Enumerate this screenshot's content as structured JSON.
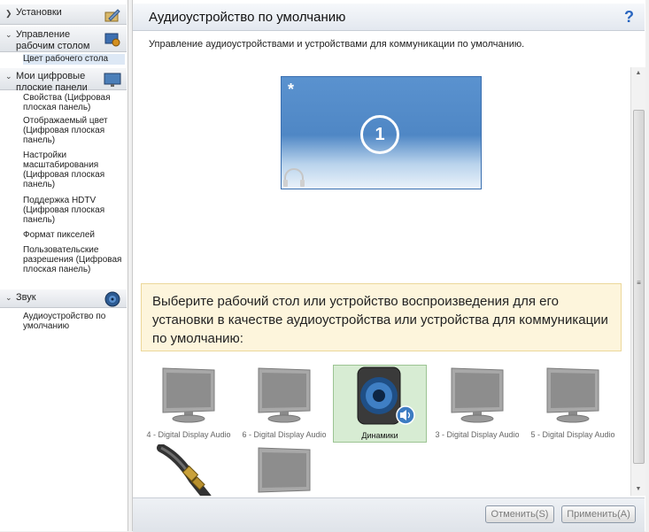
{
  "sidebar": {
    "sections": [
      {
        "label": "Установки"
      },
      {
        "label": "Управление рабочим столом"
      },
      {
        "label": "Мои цифровые плоские панели"
      },
      {
        "label": "Звук"
      }
    ],
    "items": [
      {
        "label": "Цвет рабочего стола"
      },
      {
        "label": "Свойства (Цифровая плоская панель)"
      },
      {
        "label": "Отображаемый цвет (Цифровая плоская панель)"
      },
      {
        "label": "Настройки масштабирования (Цифровая плоская панель)"
      },
      {
        "label": "Поддержка HDTV (Цифровая плоская панель)"
      },
      {
        "label": "Формат пикселей"
      },
      {
        "label": "Пользовательские разрешения (Цифровая плоская панель)"
      },
      {
        "label": "Аудиоустройство по умолчанию"
      }
    ]
  },
  "main": {
    "title": "Аудиоустройство по умолчанию",
    "help": "?",
    "description": "Управление аудиоустройствами и устройствами для коммуникации по умолчанию.",
    "desktop": {
      "star": "*",
      "number": "1"
    },
    "info": "Выберите рабочий стол или устройство воспроизведения для его установки в качестве аудиоустройства или устройства для коммуникации по умолчанию:",
    "devices": [
      {
        "label": "4 - Digital Display Audio",
        "icon": "monitor-icon"
      },
      {
        "label": "6 - Digital Display Audio",
        "icon": "monitor-icon"
      },
      {
        "label": "Динамики",
        "icon": "speaker-icon",
        "selected": true
      },
      {
        "label": "3 - Digital Display Audio",
        "icon": "monitor-icon"
      },
      {
        "label": "5 - Digital Display Audio",
        "icon": "monitor-icon"
      },
      {
        "label": "",
        "icon": "cable-icon"
      },
      {
        "label": "",
        "icon": "monitor-icon"
      }
    ],
    "buttons": {
      "cancel": "Отменить(S)",
      "apply": "Применить(A)"
    }
  }
}
